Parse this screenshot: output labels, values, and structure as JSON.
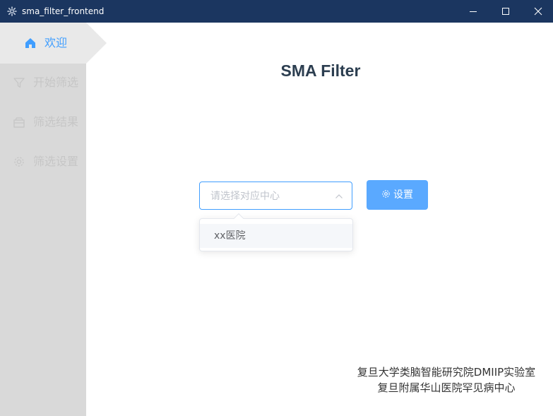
{
  "window": {
    "title": "sma_filter_frontend",
    "controls": {
      "minimize": "minimize-icon",
      "maximize": "maximize-icon",
      "close": "close-icon"
    }
  },
  "sidebar": {
    "items": [
      {
        "label": "欢迎",
        "icon": "home-icon",
        "active": true
      },
      {
        "label": "开始筛选",
        "icon": "filter-icon",
        "active": false
      },
      {
        "label": "筛选结果",
        "icon": "box-icon",
        "active": false
      },
      {
        "label": "筛选设置",
        "icon": "gear-icon",
        "active": false
      }
    ]
  },
  "main": {
    "title": "SMA Filter",
    "select": {
      "placeholder": "请选择对应中心"
    },
    "setting_button": {
      "label": "设置",
      "icon": "gear-icon"
    },
    "dropdown": {
      "options": [
        "xx医院"
      ]
    }
  },
  "footer": {
    "line1": "复旦大学类脑智能研究院DMIIP实验室",
    "line2": "复旦附属华山医院罕见病中心"
  },
  "colors": {
    "titlebar": "#1b3660",
    "accent": "#409eff",
    "button": "#5aa9ff",
    "sidebar": "#d9d9d9",
    "sidebar_inactive_text": "#c6c6c6"
  }
}
